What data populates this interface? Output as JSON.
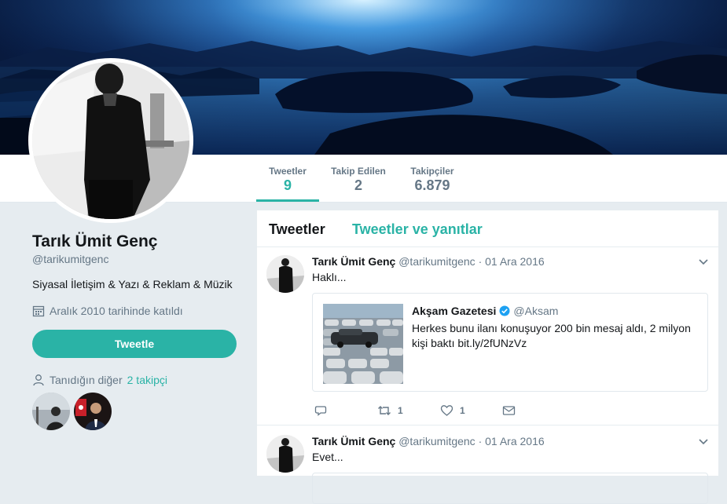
{
  "profile": {
    "name": "Tarık Ümit Genç",
    "handle": "@tarikumitgenc",
    "bio": "Siyasal İletişim & Yazı & Reklam & Müzik",
    "joined": "Aralık 2010 tarihinde katıldı",
    "tweet_button": "Tweetle",
    "followers_you_know_prefix": "Tanıdığın diğer",
    "followers_you_know_link": "2 takipçi"
  },
  "nav": {
    "stats": [
      {
        "label": "Tweetler",
        "value": "9",
        "active": true
      },
      {
        "label": "Takip Edilen",
        "value": "2",
        "active": false
      },
      {
        "label": "Takipçiler",
        "value": "6.879",
        "active": false
      }
    ]
  },
  "timeline": {
    "tabs": [
      {
        "label": "Tweetler"
      },
      {
        "label": "Tweetler ve yanıtlar"
      }
    ],
    "tweets": [
      {
        "name": "Tarık Ümit Genç",
        "handle": "@tarikumitgenc",
        "date": "· 01 Ara 2016",
        "text": "Haklı...",
        "quote": {
          "name": "Akşam Gazetesi",
          "handle": "@Aksam",
          "text": "Herkes bunu ilanı konuşuyor 200 bin mesaj aldı, 2 milyon kişi baktı bit.ly/2fUNzVz"
        },
        "retweets": "1",
        "likes": "1"
      },
      {
        "name": "Tarık Ümit Genç",
        "handle": "@tarikumitgenc",
        "date": "· 01 Ara 2016",
        "text": "Evet..."
      }
    ]
  },
  "colors": {
    "accent": "#2ab3a6",
    "background": "#e6ecf0",
    "muted": "#657786",
    "verified": "#1da1f2"
  }
}
